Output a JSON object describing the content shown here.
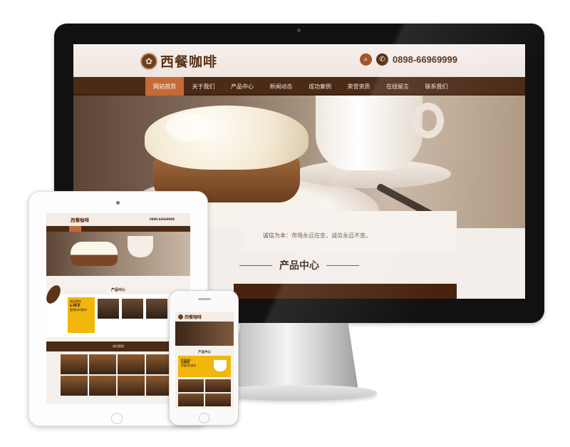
{
  "desktop": {
    "logo_text": "西餐咖啡",
    "phone": "0898-66969999",
    "nav": [
      "网站首页",
      "关于我们",
      "产品中心",
      "新闻动态",
      "成功案例",
      "荣誉资质",
      "在线留言",
      "联系我们"
    ],
    "active_nav": "网站首页",
    "quote": "诚信为本：市场永远在变，诚信永远不变。",
    "section_title": "产品中心"
  },
  "tablet": {
    "logo_text": "西餐咖啡",
    "phone": "0898-66969999",
    "section_title": "产品中心",
    "promo_small": "精选美味",
    "promo_big": "LIKE",
    "promo_sub": "更懂你的需求",
    "case_title": "成功案例"
  },
  "phone": {
    "logo_text": "西餐咖啡",
    "section_title": "产品中心",
    "promo_small": "精选美味",
    "promo_big": "LIKE",
    "promo_sub": "更懂你的需求"
  },
  "colors": {
    "brand_brown": "#4b2a16",
    "accent_orange": "#c46a39",
    "accent_yellow": "#f2b70c"
  }
}
